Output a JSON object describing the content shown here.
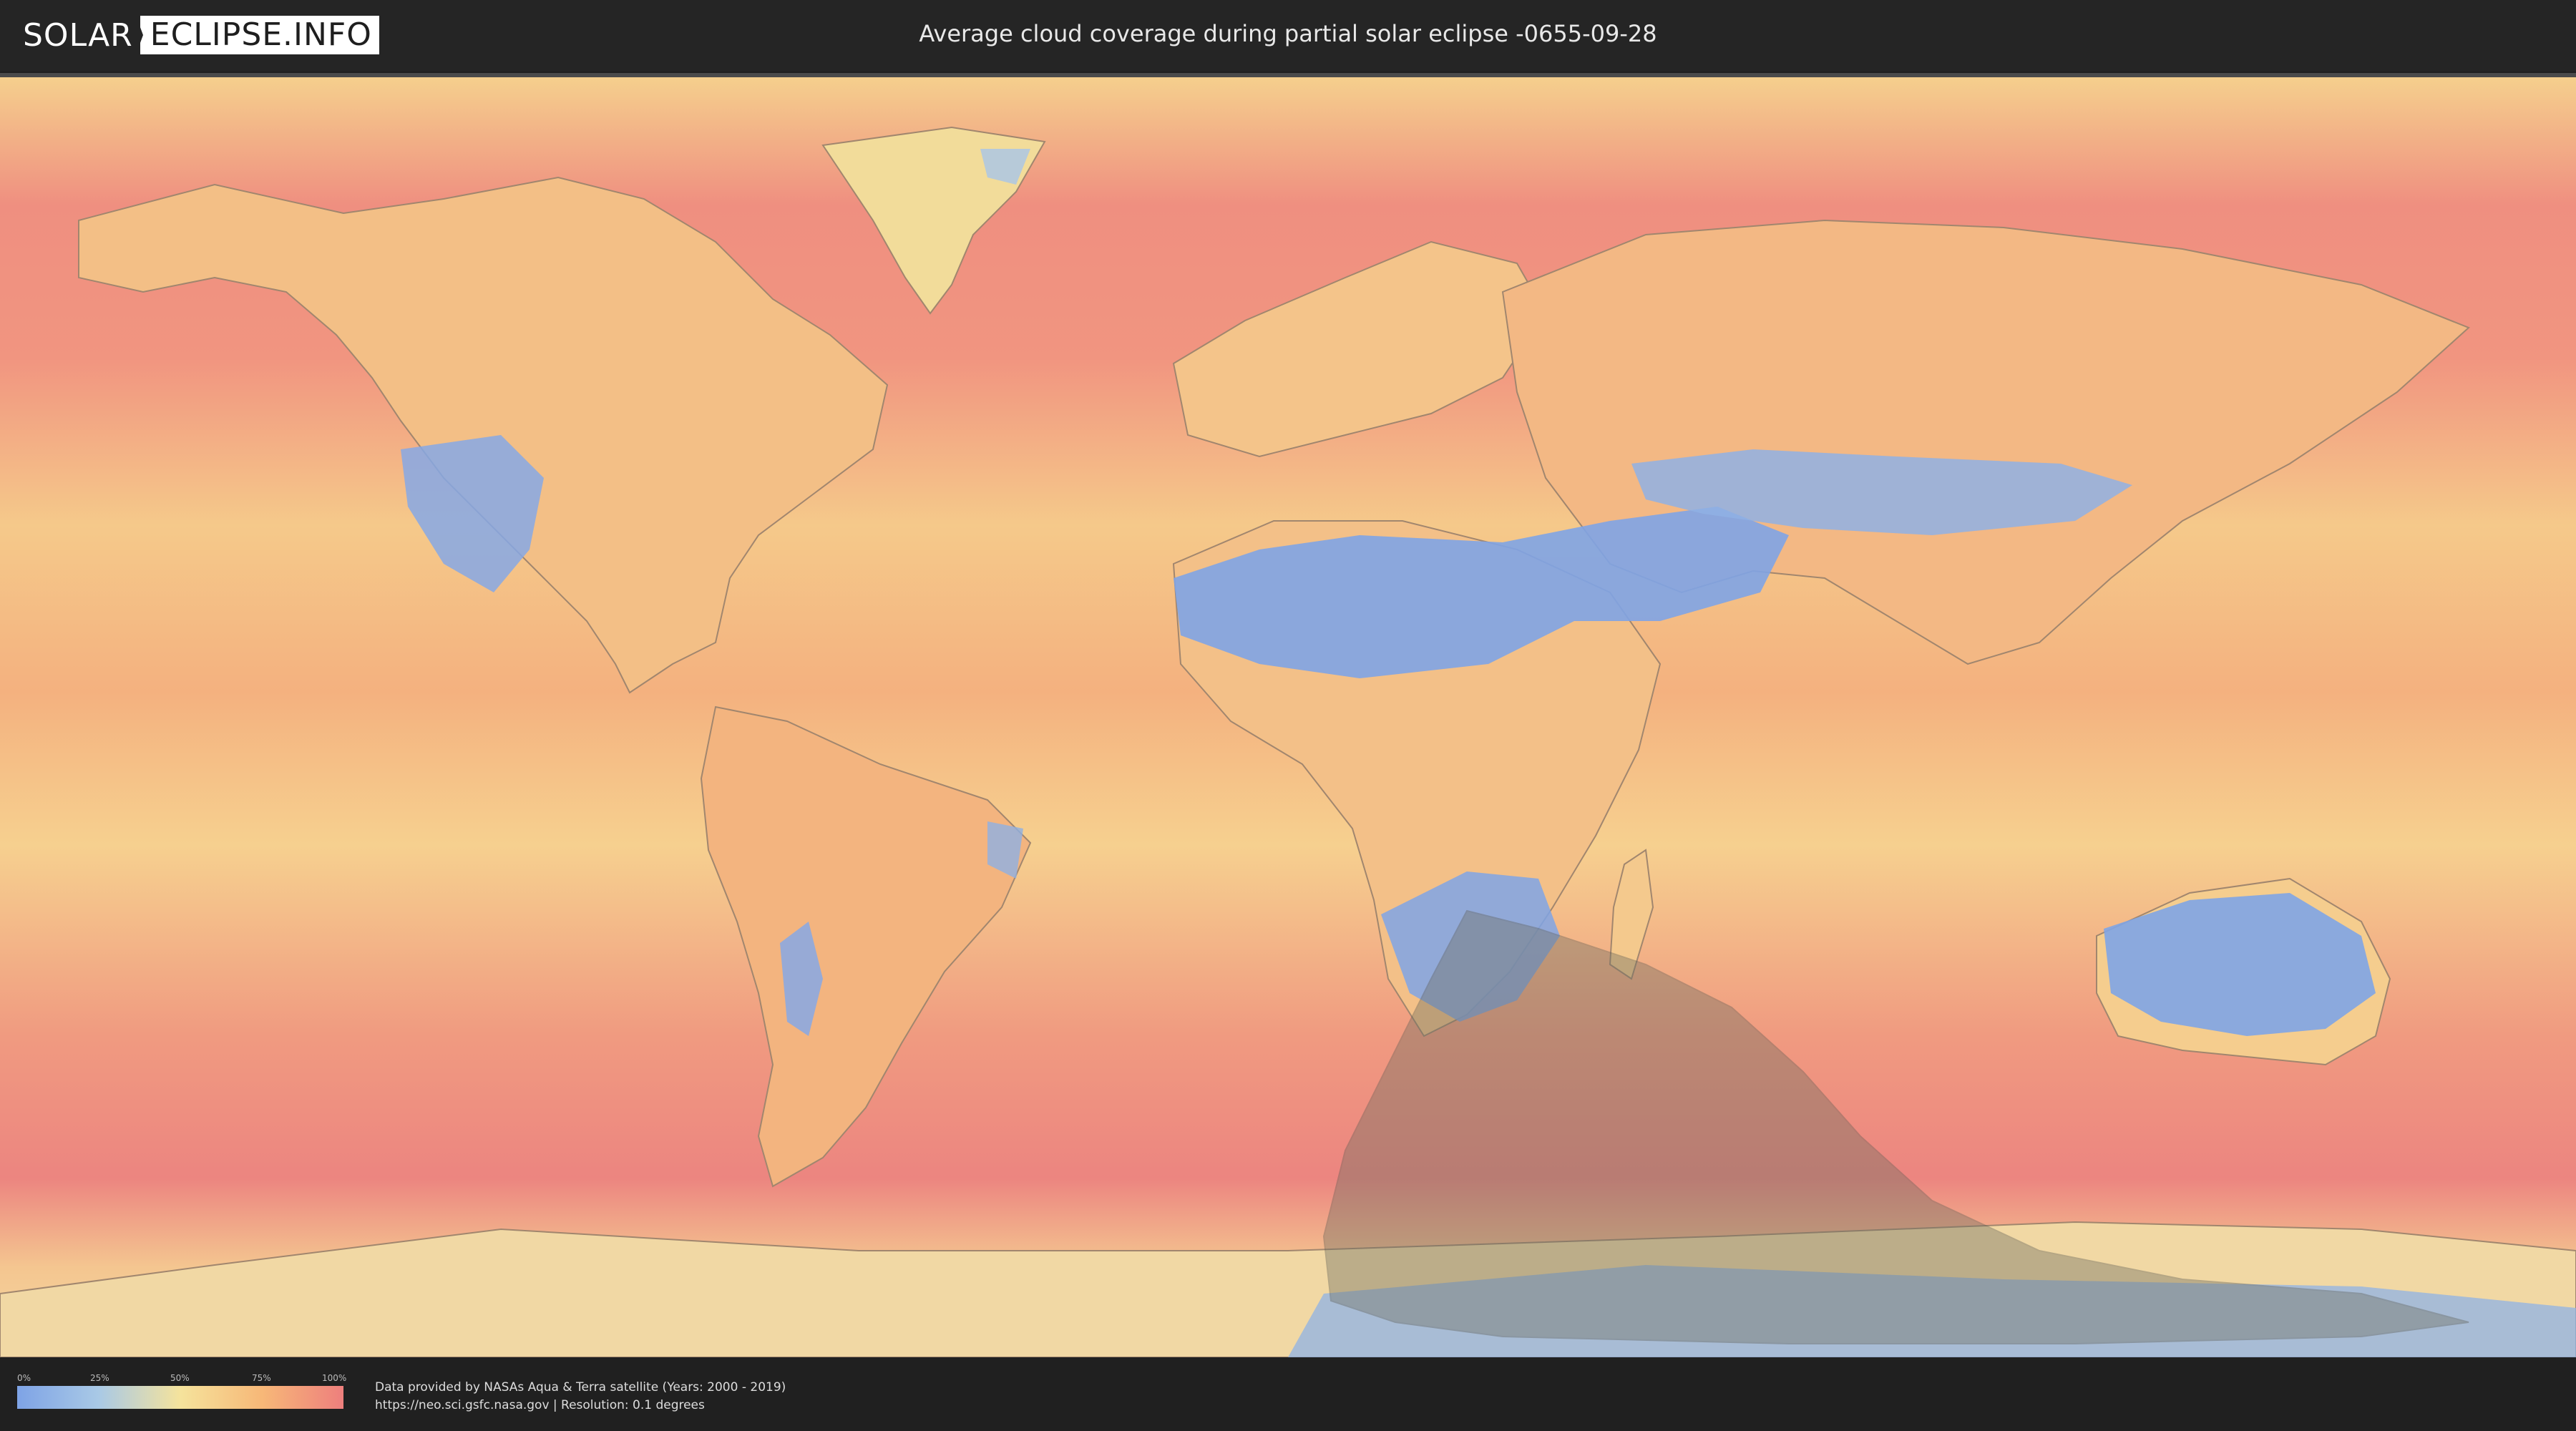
{
  "logo": {
    "left_text": "SOLAR",
    "right_text": "ECLIPSE.INFO"
  },
  "title": "Average cloud coverage during partial solar eclipse -0655-09-28",
  "legend": {
    "ticks": [
      "0%",
      "25%",
      "50%",
      "75%",
      "100%"
    ],
    "colors": [
      "#7ea3e6",
      "#a9c9e6",
      "#f5e39c",
      "#f7b878",
      "#ee7f7d"
    ]
  },
  "credits": {
    "line1": "Data provided by NASAs Aqua & Terra satellite (Years: 2000 - 2019)",
    "line2": "https://neo.sci.gsfc.nasa.gov | Resolution: 0.1 degrees"
  },
  "map": {
    "ocean_color": "#f3a57f",
    "shadow_color": "#6f6f62"
  }
}
